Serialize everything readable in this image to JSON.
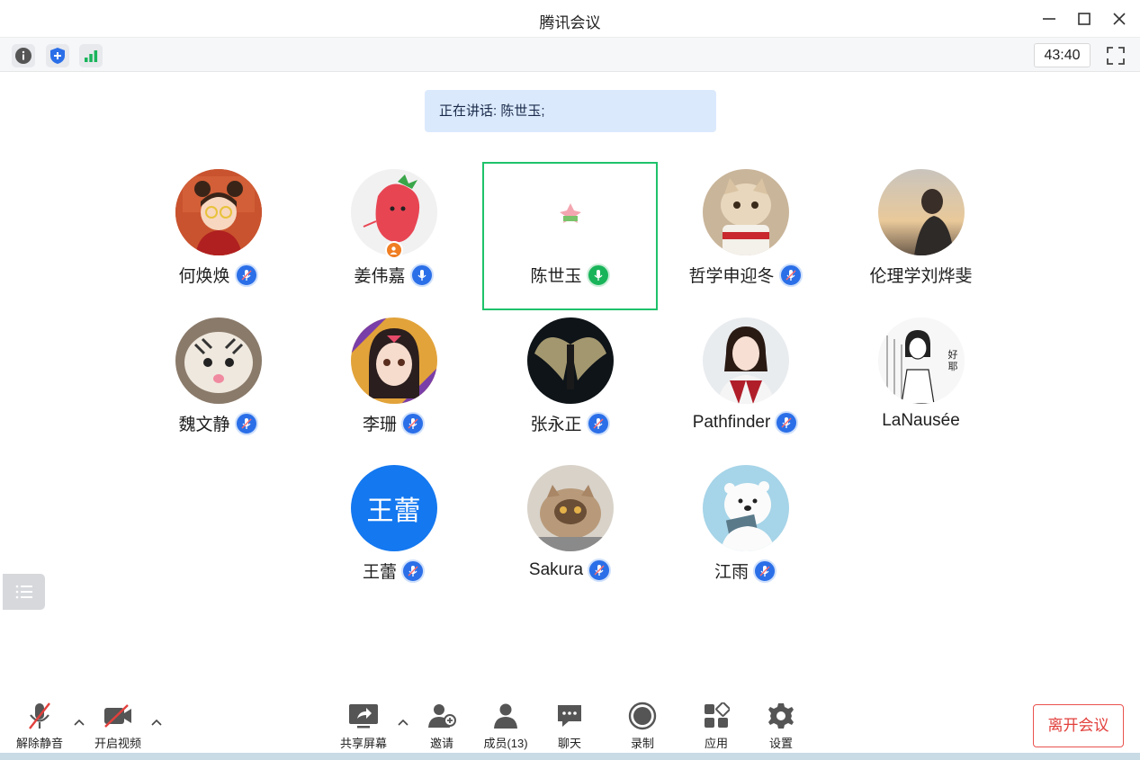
{
  "window": {
    "title": "腾讯会议"
  },
  "toolbar": {
    "timer": "43:40"
  },
  "speaking": {
    "text": "正在讲话: 陈世玉;"
  },
  "participants": [
    {
      "name": "何焕焕",
      "mic": "muted",
      "avatar": "cartoon-girl-red"
    },
    {
      "name": "姜伟嘉",
      "mic": "muted",
      "avatar": "strawberry-cartoon",
      "host_badge": true
    },
    {
      "name": "陈世玉",
      "mic": "speaking",
      "avatar": "patrick-star",
      "active": true
    },
    {
      "name": "哲学申迎冬",
      "mic": "muted",
      "avatar": "cat-with-cup"
    },
    {
      "name": "伦理学刘烨斐",
      "mic": "none",
      "avatar": "man-sunset"
    },
    {
      "name": "魏文静",
      "mic": "muted",
      "avatar": "tiger-plush"
    },
    {
      "name": "李珊",
      "mic": "muted",
      "avatar": "anime-girl"
    },
    {
      "name": "张永正",
      "mic": "muted",
      "avatar": "dark-wings"
    },
    {
      "name": "Pathfinder",
      "mic": "muted",
      "avatar": "girl-photo"
    },
    {
      "name": "LaNausée",
      "mic": "none",
      "avatar": "manga-sketch",
      "avatar_text": "好耶"
    },
    {
      "name": "王蕾",
      "mic": "muted",
      "avatar": "text-avatar",
      "avatar_text": "王蕾"
    },
    {
      "name": "Sakura",
      "mic": "muted",
      "avatar": "persian-cat"
    },
    {
      "name": "江雨",
      "mic": "muted",
      "avatar": "polar-bear"
    }
  ],
  "bottom": {
    "unmute": "解除静音",
    "start_video": "开启视频",
    "share_screen": "共享屏幕",
    "invite": "邀请",
    "members": "成员(13)",
    "chat": "聊天",
    "record": "录制",
    "apps": "应用",
    "settings": "设置",
    "leave": "离开会议"
  },
  "colors": {
    "accent_blue": "#2b6fe8",
    "speaking_green": "#1fc26b",
    "leave_red": "#e2403c",
    "banner_bg": "#dbe9fc"
  }
}
